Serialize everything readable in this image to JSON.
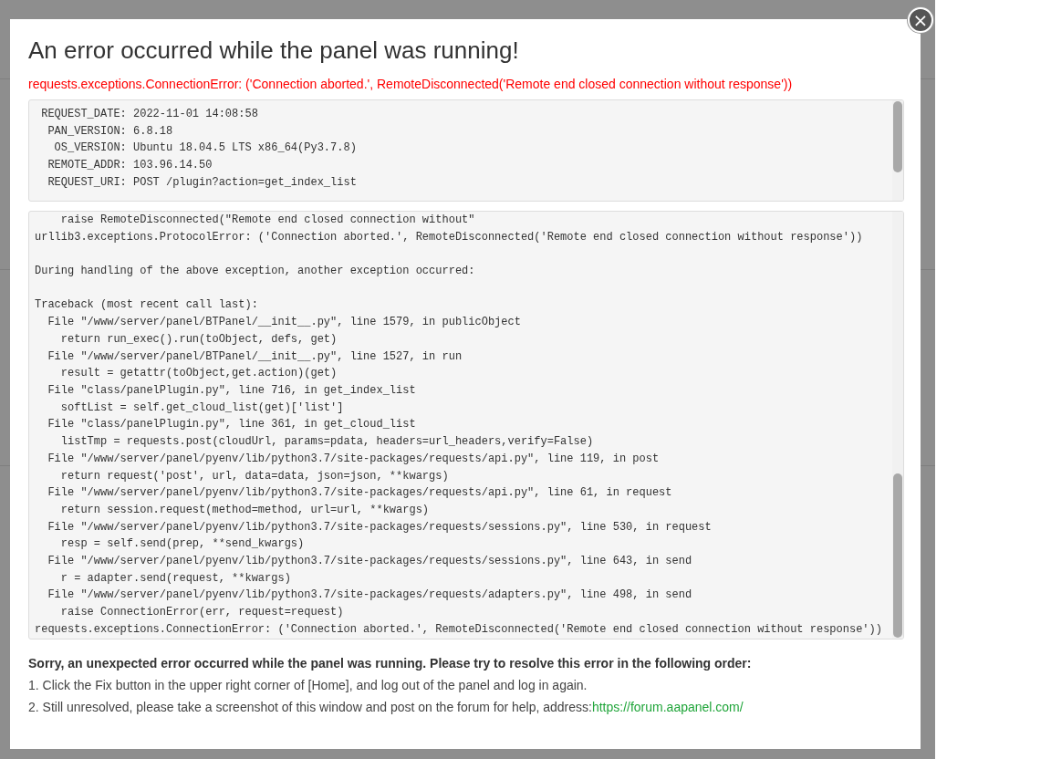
{
  "dialog": {
    "title": "An error occurred while the panel was running!",
    "error_summary": "requests.exceptions.ConnectionError: ('Connection aborted.', RemoteDisconnected('Remote end closed connection without response'))",
    "close_button": "×",
    "request_info": {
      "lines": [
        " REQUEST_DATE: 2022-11-01 14:08:58",
        "  PAN_VERSION: 6.8.18",
        "   OS_VERSION: Ubuntu 18.04.5 LTS x86_64(Py3.7.8)",
        "  REMOTE_ADDR: 103.96.14.50",
        "  REQUEST_URI: POST /plugin?action=get_index_list"
      ]
    },
    "traceback": {
      "blocks": [
        [
          "    raise RemoteDisconnected(\"Remote end closed connection without\"",
          "urllib3.exceptions.ProtocolError: ('Connection aborted.', RemoteDisconnected('Remote end closed connection without response'))"
        ],
        [
          "During handling of the above exception, another exception occurred:"
        ],
        [
          "Traceback (most recent call last):",
          "  File \"/www/server/panel/BTPanel/__init__.py\", line 1579, in publicObject",
          "    return run_exec().run(toObject, defs, get)",
          "  File \"/www/server/panel/BTPanel/__init__.py\", line 1527, in run",
          "    result = getattr(toObject,get.action)(get)",
          "  File \"class/panelPlugin.py\", line 716, in get_index_list",
          "    softList = self.get_cloud_list(get)['list']",
          "  File \"class/panelPlugin.py\", line 361, in get_cloud_list",
          "    listTmp = requests.post(cloudUrl, params=pdata, headers=url_headers,verify=False)",
          "  File \"/www/server/panel/pyenv/lib/python3.7/site-packages/requests/api.py\", line 119, in post",
          "    return request('post', url, data=data, json=json, **kwargs)",
          "  File \"/www/server/panel/pyenv/lib/python3.7/site-packages/requests/api.py\", line 61, in request",
          "    return session.request(method=method, url=url, **kwargs)",
          "  File \"/www/server/panel/pyenv/lib/python3.7/site-packages/requests/sessions.py\", line 530, in request",
          "    resp = self.send(prep, **send_kwargs)",
          "  File \"/www/server/panel/pyenv/lib/python3.7/site-packages/requests/sessions.py\", line 643, in send",
          "    r = adapter.send(request, **kwargs)",
          "  File \"/www/server/panel/pyenv/lib/python3.7/site-packages/requests/adapters.py\", line 498, in send",
          "    raise ConnectionError(err, request=request)",
          "requests.exceptions.ConnectionError: ('Connection aborted.', RemoteDisconnected('Remote end closed connection without response'))"
        ]
      ]
    },
    "help": {
      "heading": "Sorry, an unexpected error occurred while the panel was running. Please try to resolve this error in the following order:",
      "steps": [
        {
          "text": "1. Click the Fix button in the upper right corner of [Home], and log out of the panel and log in again."
        },
        {
          "text": "2. Still unresolved, please take a screenshot of this window and post on the forum for help, address:",
          "link": "https://forum.aapanel.com/"
        }
      ]
    }
  }
}
